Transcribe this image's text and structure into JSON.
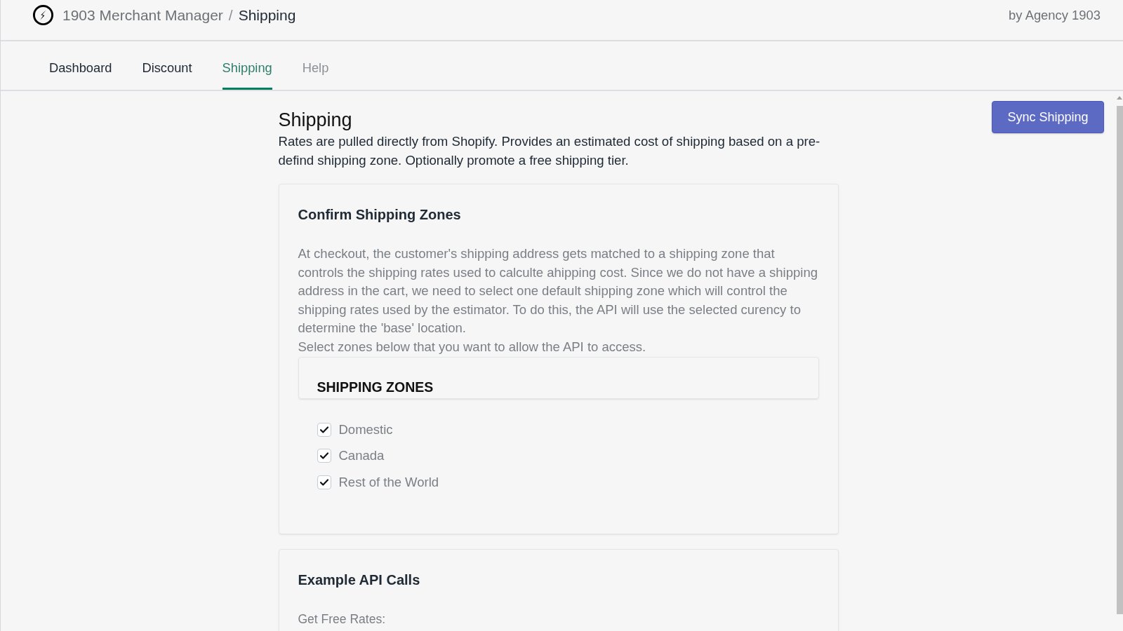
{
  "header": {
    "app_name": "1903 Merchant Manager",
    "separator": "/",
    "page": "Shipping",
    "byline": "by Agency 1903"
  },
  "tabs": [
    {
      "label": "Dashboard",
      "selected": false,
      "disabled": false
    },
    {
      "label": "Discount",
      "selected": false,
      "disabled": false
    },
    {
      "label": "Shipping",
      "selected": true,
      "disabled": false
    },
    {
      "label": "Help",
      "selected": false,
      "disabled": true
    }
  ],
  "page": {
    "title": "Shipping",
    "description": "Rates are pulled directly from Shopify. Provides an estimated cost of shipping based on a pre-defind shipping zone. Optionally promote a free shipping tier.",
    "action_button": "Sync Shipping"
  },
  "zones_card": {
    "title": "Confirm Shipping Zones",
    "paragraphs": [
      "At checkout, the customer's shipping address gets matched to a shipping zone that controls the shipping rates used to calculte ahipping cost. Since we do not have a shipping address in the cart, we need to select one default shipping zone which will control the shipping rates used by the estimator. To do this, the API will use the selected curency to determine the 'base' location.",
      "Select zones below that you want to allow the API to access."
    ],
    "zones_heading": "SHIPPING ZONES",
    "zones": [
      {
        "label": "Domestic",
        "checked": true
      },
      {
        "label": "Canada",
        "checked": true
      },
      {
        "label": "Rest of the World",
        "checked": true
      }
    ]
  },
  "api_card": {
    "title": "Example API Calls",
    "label": "Get Free Rates:"
  }
}
